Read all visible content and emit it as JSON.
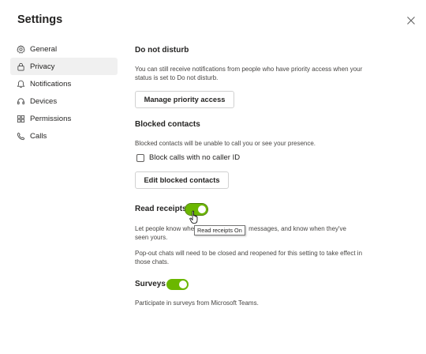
{
  "header": {
    "title": "Settings",
    "close_icon": "close-icon"
  },
  "sidebar": {
    "items": [
      {
        "label": "General",
        "icon": "gear-icon",
        "active": false
      },
      {
        "label": "Privacy",
        "icon": "lock-icon",
        "active": true
      },
      {
        "label": "Notifications",
        "icon": "bell-icon",
        "active": false
      },
      {
        "label": "Devices",
        "icon": "headset-icon",
        "active": false
      },
      {
        "label": "Permissions",
        "icon": "grid-icon",
        "active": false
      },
      {
        "label": "Calls",
        "icon": "phone-icon",
        "active": false
      }
    ]
  },
  "dnd": {
    "heading": "Do not disturb",
    "desc": "You can still receive notifications from people who have priority access when your status is set to Do not disturb.",
    "button": "Manage priority access"
  },
  "blocked": {
    "heading": "Blocked contacts",
    "desc": "Blocked contacts will be unable to call you or see your presence.",
    "checkbox_label": "Block calls with no caller ID",
    "checkbox_checked": false,
    "button": "Edit blocked contacts"
  },
  "read_receipts": {
    "heading": "Read receipts",
    "toggle_on": true,
    "desc_part1": "Let people know whe",
    "desc_part2": "messages, and know when they've",
    "desc_line2": "seen yours.",
    "desc2": "Pop-out chats will need to be closed and reopened for this setting to take effect in those chats.",
    "tooltip": "Read receipts On"
  },
  "surveys": {
    "heading": "Surveys",
    "toggle_on": true,
    "desc": "Participate in surveys from Microsoft Teams."
  },
  "colors": {
    "accent_green": "#6bb700",
    "active_bg": "#f0f0f0"
  }
}
